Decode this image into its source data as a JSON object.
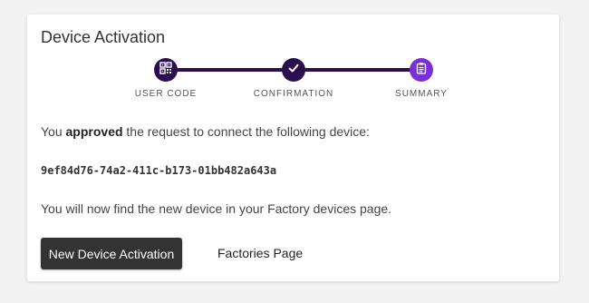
{
  "card": {
    "title": "Device Activation"
  },
  "stepper": {
    "steps": [
      {
        "label": "USER CODE",
        "icon": "qr-code-icon",
        "color": "#2a0e4e"
      },
      {
        "label": "CONFIRMATION",
        "icon": "checkmark-icon",
        "color": "#2a0e4e"
      },
      {
        "label": "SUMMARY",
        "icon": "clipboard-icon",
        "color": "#7b2fd8"
      }
    ]
  },
  "message": {
    "prefix": "You ",
    "emphasis": "approved",
    "suffix": " the request to connect the following device:",
    "device_id": "9ef84d76-74a2-411c-b173-01bb482a643a",
    "followup": "You will now find the new device in your Factory devices page."
  },
  "actions": {
    "primary_label": "New Device Activation",
    "secondary_label": "Factories Page"
  }
}
